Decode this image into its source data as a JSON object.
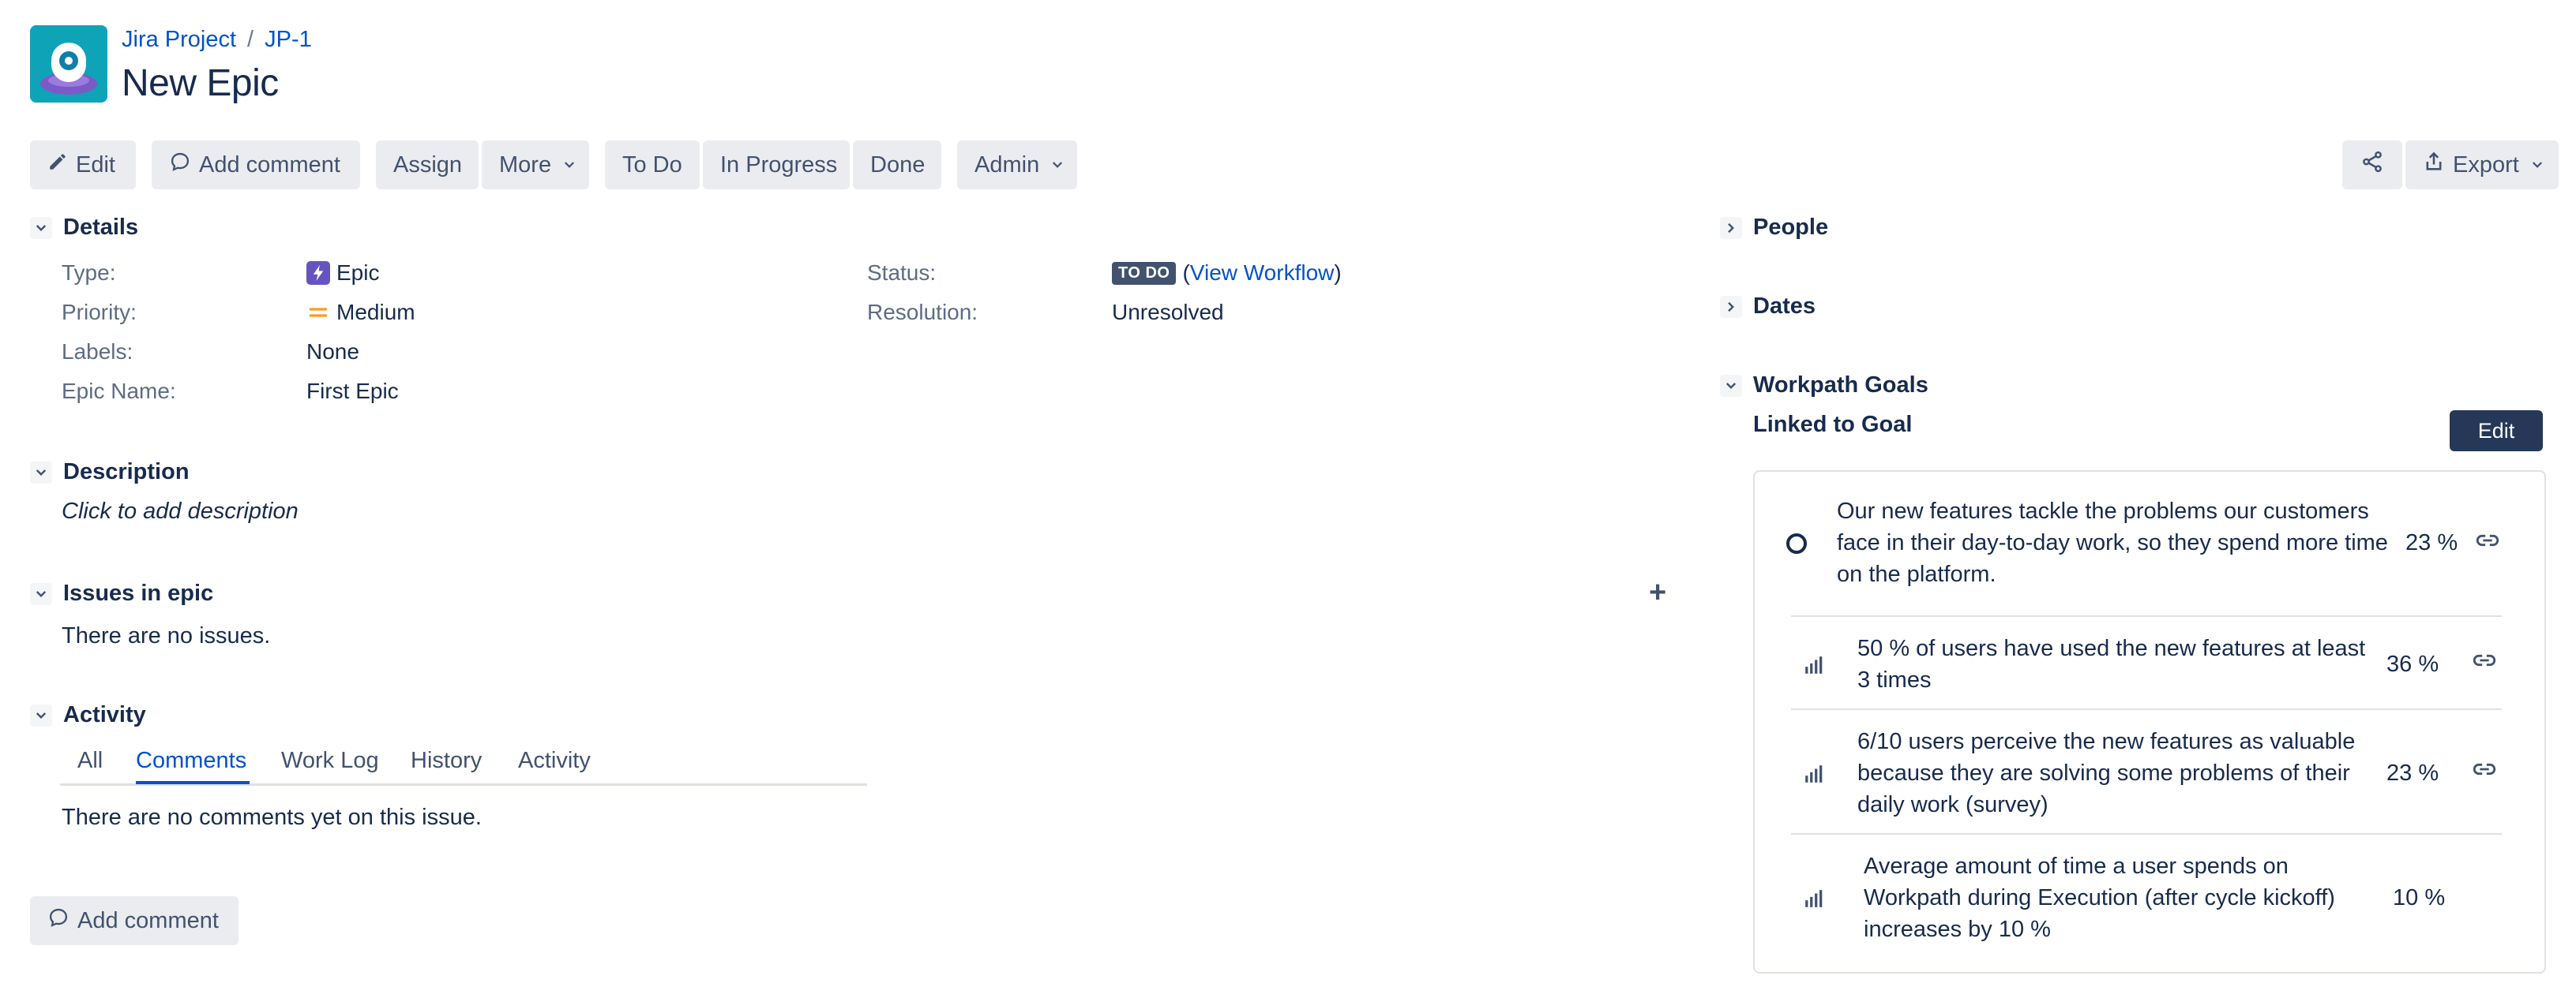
{
  "breadcrumb": {
    "project": "Jira Project",
    "separator": "/",
    "issue_key": "JP-1"
  },
  "title": "New Epic",
  "toolbar": {
    "edit": "Edit",
    "add_comment": "Add comment",
    "assign": "Assign",
    "more": "More",
    "todo": "To Do",
    "in_progress": "In Progress",
    "done": "Done",
    "admin": "Admin",
    "export": "Export"
  },
  "details": {
    "heading": "Details",
    "type_label": "Type:",
    "type_value": "Epic",
    "priority_label": "Priority:",
    "priority_value": "Medium",
    "labels_label": "Labels:",
    "labels_value": "None",
    "epic_name_label": "Epic Name:",
    "epic_name_value": "First Epic",
    "status_label": "Status:",
    "status_value": "TO DO",
    "workflow_open": "(",
    "workflow_link": "View Workflow",
    "workflow_close": ")",
    "resolution_label": "Resolution:",
    "resolution_value": "Unresolved"
  },
  "description": {
    "heading": "Description",
    "placeholder": "Click to add description"
  },
  "issues_in_epic": {
    "heading": "Issues in epic",
    "empty": "There are no issues.",
    "add_symbol": "+"
  },
  "activity": {
    "heading": "Activity",
    "tabs": [
      "All",
      "Comments",
      "Work Log",
      "History",
      "Activity"
    ],
    "active_tab": "Comments",
    "empty": "There are no comments yet on this issue.",
    "add_comment": "Add comment"
  },
  "right_panel": {
    "people": "People",
    "dates": "Dates",
    "workpath_goals": "Workpath Goals",
    "linked_to_goal": "Linked to Goal",
    "edit": "Edit",
    "goal": {
      "text": "Our new features tackle the problems our customers face in their day-to-day work, so they spend more time on the platform.",
      "progress": "23 %"
    },
    "key_results": [
      {
        "text": "50 % of users have used the new features at least 3 times",
        "progress": "36 %"
      },
      {
        "text": "6/10 users perceive the new features as valuable because they are solving some problems of their daily work (survey)",
        "progress": "23 %"
      },
      {
        "text": "Average amount of time a user spends on Workpath during Execution (after cycle kickoff) increases by 10 %",
        "progress": "10 %"
      }
    ]
  },
  "colors": {
    "link": "#0052cc",
    "text": "#172b4d",
    "button_bg": "#ebecf0",
    "epic_purple": "#6554c0",
    "priority_orange": "#ff991f"
  }
}
